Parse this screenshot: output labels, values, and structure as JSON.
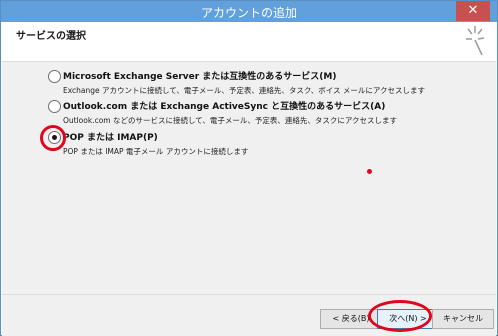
{
  "window": {
    "title": "アカウントの追加",
    "close_glyph": "✕"
  },
  "header": {
    "title": "サービスの選択",
    "icon": "wizard-sparkle-icon"
  },
  "options": [
    {
      "label": "Microsoft Exchange Server または互換性のあるサービス(M)",
      "description": "Exchange アカウントに接続して、電子メール、予定表、連絡先、タスク、ボイス メールにアクセスします",
      "selected": false
    },
    {
      "label": "Outlook.com または Exchange ActiveSync と互換性のあるサービス(A)",
      "description": "Outlook.com などのサービスに接続して、電子メール、予定表、連絡先、タスクにアクセスします",
      "selected": false
    },
    {
      "label": "POP または IMAP(P)",
      "description": "POP または IMAP 電子メール アカウントに接続します",
      "selected": true
    }
  ],
  "buttons": {
    "back": "< 戻る(B)",
    "next": "次へ(N) >",
    "cancel": "キャンセル"
  },
  "colors": {
    "annotation": "#e0061e",
    "titlebar": "#62a0dc",
    "close": "#c75050"
  }
}
